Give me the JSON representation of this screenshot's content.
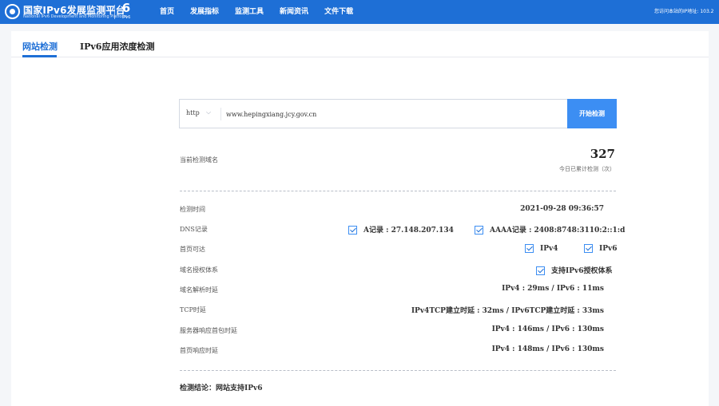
{
  "header": {
    "title": "国家IPv6发展监测平台",
    "subtitle": "National IPv6 Development and Monitoring Platform",
    "mark_text": "IPv6",
    "nav": [
      "首页",
      "发展指标",
      "监测工具",
      "新闻资讯",
      "文件下载"
    ],
    "ip_notice": "您访问本站的IP地址: 103.2"
  },
  "tabs": [
    {
      "label": "网站检测",
      "active": true
    },
    {
      "label": "IPv6应用浓度检测",
      "active": false
    }
  ],
  "search": {
    "scheme": "http",
    "url": "www.hepingxiang.jcy.gov.cn",
    "button": "开始检测"
  },
  "summary": {
    "domain_label": "当前检测域名",
    "count": "327",
    "count_caption": "今日已累计检测（次）"
  },
  "rows": {
    "time_label": "检测时间",
    "time_value": "2021-09-28 09:36:57",
    "dns_label": "DNS记录",
    "dns_a": "A记录 : 27.148.207.134",
    "dns_aaaa": "AAAA记录 : 2408:8748:3110:2::1:d",
    "reach_label": "首页可达",
    "reach_v4": "IPv4",
    "reach_v6": "IPv6",
    "auth_label": "域名授权体系",
    "auth_value": "支持IPv6授权体系",
    "resolve_label": "域名解析时延",
    "resolve_value": "IPv4 : 29ms / IPv6 : 11ms",
    "tcp_label": "TCP时延",
    "tcp_value": "IPv4TCP建立时延 : 32ms / IPv6TCP建立时延 : 33ms",
    "server_label": "服务器响应首包时延",
    "server_value": "IPv4 : 146ms / IPv6 : 130ms",
    "page_label": "首页响应时延",
    "page_value": "IPv4 : 148ms / IPv6 : 130ms"
  },
  "conclusion": "检测结论：网站支持IPv6",
  "colors": {
    "primary": "#1e6fd6",
    "button": "#3c8ef3"
  }
}
